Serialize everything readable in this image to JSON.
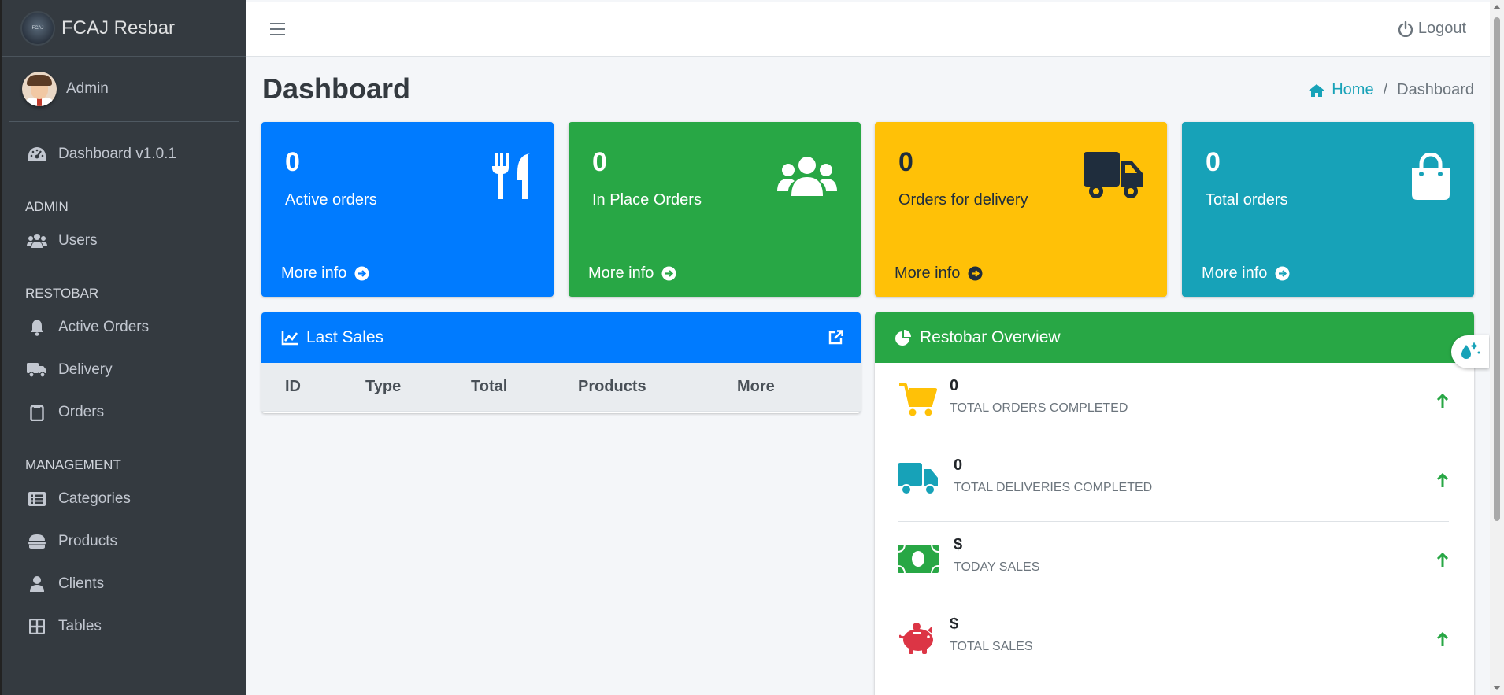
{
  "brand": {
    "name": "FCAJ Resbar",
    "logo_text": "FCAJ"
  },
  "user": {
    "name": "Admin"
  },
  "sidebar": {
    "dashboard": "Dashboard v1.0.1",
    "sections": [
      {
        "header": "ADMIN",
        "items": [
          {
            "label": "Users",
            "icon": "users-icon"
          }
        ]
      },
      {
        "header": "RESTOBAR",
        "items": [
          {
            "label": "Active Orders",
            "icon": "bell-icon"
          },
          {
            "label": "Delivery",
            "icon": "truck-icon"
          },
          {
            "label": "Orders",
            "icon": "clipboard-icon"
          }
        ]
      },
      {
        "header": "MANAGEMENT",
        "items": [
          {
            "label": "Categories",
            "icon": "list-icon"
          },
          {
            "label": "Products",
            "icon": "hamburger-food-icon"
          },
          {
            "label": "Clients",
            "icon": "user-icon"
          },
          {
            "label": "Tables",
            "icon": "grid-icon"
          }
        ]
      }
    ]
  },
  "topbar": {
    "logout": "Logout"
  },
  "page": {
    "title": "Dashboard"
  },
  "breadcrumb": {
    "home": "Home",
    "current": "Dashboard"
  },
  "stat_boxes": [
    {
      "value": "0",
      "label": "Active orders",
      "more": "More info",
      "color": "#007bff",
      "icon": "utensils-icon"
    },
    {
      "value": "0",
      "label": "In Place Orders",
      "more": "More info",
      "color": "#28a745",
      "icon": "users-icon"
    },
    {
      "value": "0",
      "label": "Orders for delivery",
      "more": "More info",
      "color": "#ffc107",
      "icon": "truck-icon"
    },
    {
      "value": "0",
      "label": "Total orders",
      "more": "More info",
      "color": "#17a2b8",
      "icon": "shopping-bag-icon"
    }
  ],
  "last_sales": {
    "title": "Last Sales",
    "columns": [
      "ID",
      "Type",
      "Total",
      "Products",
      "More"
    ]
  },
  "overview": {
    "title": "Restobar Overview",
    "items": [
      {
        "value": "0",
        "label": "TOTAL ORDERS COMPLETED",
        "icon": "cart-icon",
        "color": "#ffc107"
      },
      {
        "value": "0",
        "label": "TOTAL DELIVERIES COMPLETED",
        "icon": "truck-icon",
        "color": "#17a2b8"
      },
      {
        "value": "$",
        "label": "TODAY SALES",
        "icon": "money-bill-icon",
        "color": "#28a745"
      },
      {
        "value": "$",
        "label": "TOTAL SALES",
        "icon": "piggy-bank-icon",
        "color": "#dc3545"
      }
    ]
  }
}
